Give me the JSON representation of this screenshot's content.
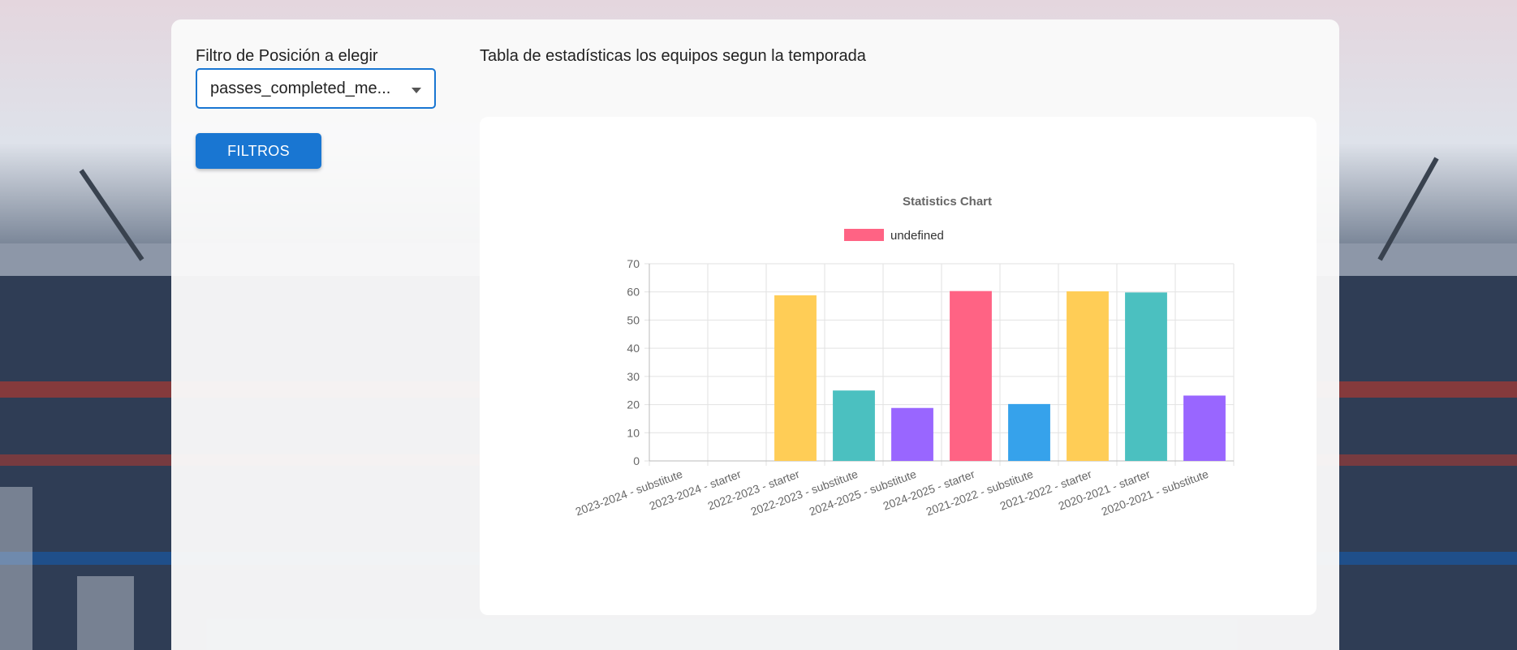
{
  "filter": {
    "label": "Filtro de Posición a elegir",
    "selected_value": "passes_completed_me..."
  },
  "filters_button": {
    "label": "FILTROS"
  },
  "table_title": "Tabla de estadísticas los equipos segun la temporada",
  "chart_data": {
    "type": "bar",
    "title": "Statistics Chart",
    "legend": [
      "undefined"
    ],
    "legend_position": "top",
    "grid": true,
    "ylim": [
      0,
      70
    ],
    "yticks": [
      0,
      10,
      20,
      30,
      40,
      50,
      60,
      70
    ],
    "categories": [
      "2023-2024 - substitute",
      "2023-2024 - starter",
      "2022-2023 - starter",
      "2022-2023 - substitute",
      "2024-2025 - substitute",
      "2024-2025 - starter",
      "2021-2022 - substitute",
      "2021-2022 - starter",
      "2020-2021 - starter",
      "2020-2021 - substitute"
    ],
    "series": [
      {
        "name": "undefined",
        "values": [
          0,
          0,
          58.8,
          25,
          18.8,
          60.3,
          20.2,
          60.2,
          59.8,
          23.2
        ],
        "colors": [
          "#ff6384",
          "#36a2eb",
          "#ffcd56",
          "#4bc0c0",
          "#9966ff",
          "#ff6384",
          "#36a2eb",
          "#ffcd56",
          "#4bc0c0",
          "#9966ff"
        ]
      }
    ]
  }
}
